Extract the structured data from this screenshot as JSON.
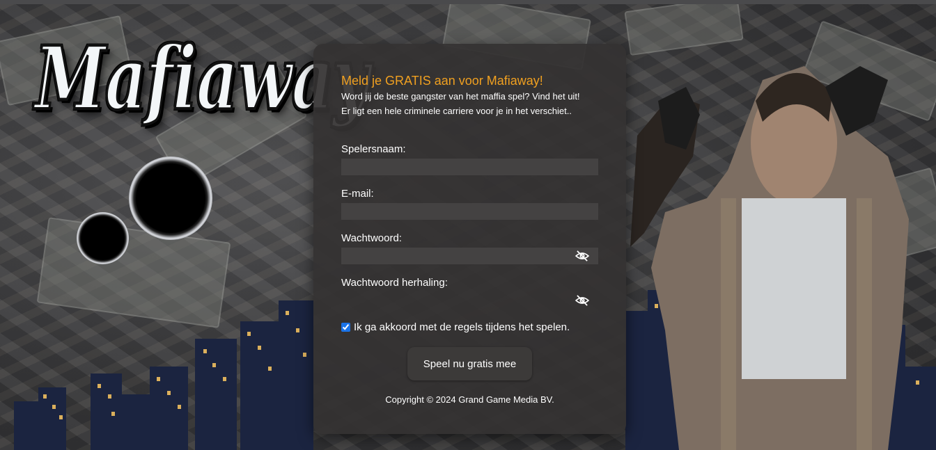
{
  "brand": {
    "logo_text": "Mafiaway"
  },
  "signup": {
    "title": "Meld je GRATIS aan voor Mafiaway!",
    "subtitle_line1": "Word jij de beste gangster van het maffia spel? Vind het uit!",
    "subtitle_line2": "Er ligt een hele criminele carriere voor je in het verschiet..",
    "fields": {
      "username_label": "Spelersnaam:",
      "username_value": "",
      "email_label": "E-mail:",
      "email_value": "",
      "password_label": "Wachtwoord:",
      "password_value": "",
      "password_repeat_label": "Wachtwoord herhaling:",
      "password_repeat_value": ""
    },
    "agree_text": "Ik ga akkoord met de regels tijdens het spelen.",
    "agree_checked": true,
    "submit_label": "Speel nu gratis mee",
    "copyright": "Copyright © 2024 Grand Game Media BV."
  },
  "icons": {
    "password_toggle": "eye-slash-icon",
    "password_repeat_toggle": "eye-slash-icon"
  },
  "colors": {
    "accent": "#f0a020",
    "panel": "#343232",
    "text": "#ffffff"
  }
}
